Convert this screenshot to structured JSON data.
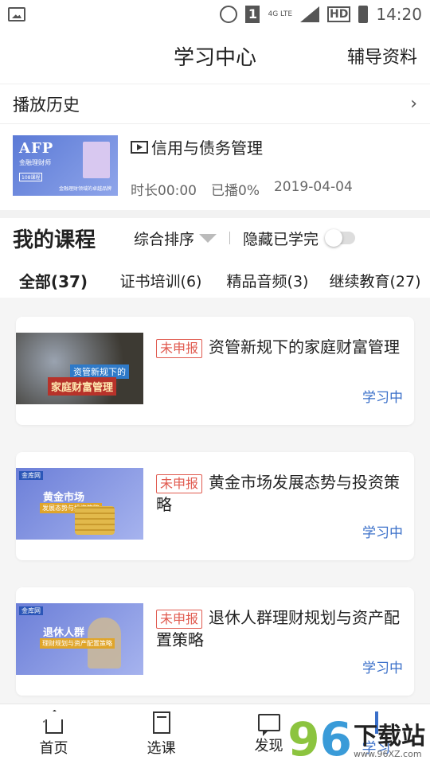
{
  "status_bar": {
    "network": "4G LTE",
    "sim": "1",
    "time": "14:20",
    "hd": "HD"
  },
  "header": {
    "title": "学习中心",
    "aux_link": "辅导资料"
  },
  "history": {
    "heading": "播放历史",
    "item": {
      "thumb_big": "AFP",
      "thumb_sub": "金融理财师",
      "thumb_tag": "108课程",
      "thumb_slogan": "金融理财领域的卓越品牌",
      "title": "信用与债务管理",
      "duration": "时长00:00",
      "progress": "已播0%",
      "date": "2019-04-04"
    }
  },
  "my_courses": {
    "heading": "我的课程",
    "sort_label": "综合排序",
    "hide_label": "隐藏已学完",
    "hide_done_enabled": false,
    "tabs": [
      {
        "label": "全部(37)",
        "active": true
      },
      {
        "label": "证书培训(6)",
        "active": false
      },
      {
        "label": "精品音频(3)",
        "active": false
      },
      {
        "label": "继续教育(27)",
        "active": false
      }
    ],
    "courses": [
      {
        "badge": "未申报",
        "title": "资管新规下的家庭财富管理",
        "state": "学习中",
        "thumb_line1": "资管新规下的",
        "thumb_line2": "家庭财富管理"
      },
      {
        "badge": "未申报",
        "title": "黄金市场发展态势与投资策略",
        "state": "学习中",
        "thumb_logo": "金库网",
        "thumb_line1": "黄金市场",
        "thumb_line2": "发展态势与投资策略"
      },
      {
        "badge": "未申报",
        "title": "退休人群理财规划与资产配置策略",
        "state": "学习中",
        "thumb_logo": "金库网",
        "thumb_line1": "退休人群",
        "thumb_line2": "理财规划与资产配置策略"
      }
    ]
  },
  "bottom_nav": [
    {
      "label": "首页",
      "icon": "home-icon"
    },
    {
      "label": "选课",
      "icon": "book-icon"
    },
    {
      "label": "发现",
      "icon": "chat-icon"
    },
    {
      "label": "学习",
      "icon": "learn-icon"
    }
  ],
  "watermark": {
    "num1": "9",
    "num2": "6",
    "text": "下载站",
    "url": "www.96XZ.com"
  },
  "colors": {
    "accent": "#3a6fc9",
    "badge": "#e05a4f"
  }
}
